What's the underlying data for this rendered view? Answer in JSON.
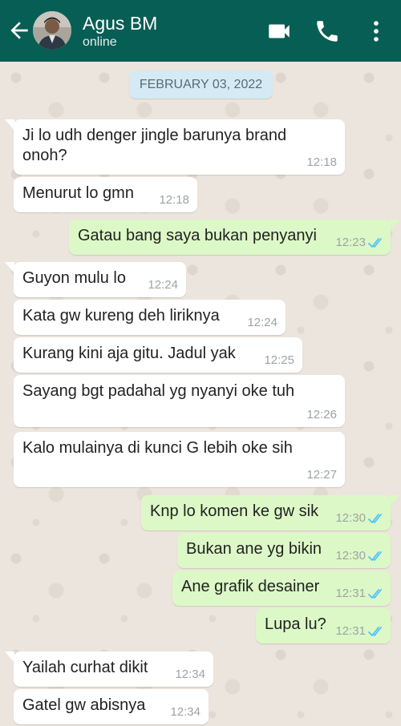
{
  "header": {
    "contact_name": "Agus BM",
    "status": "online",
    "icons": [
      "back-arrow-icon",
      "video-call-icon",
      "phone-icon",
      "more-vert-icon"
    ],
    "colors": {
      "bar": "#075e54",
      "text": "#ffffff"
    }
  },
  "chat": {
    "date_chip": "FEBRUARY 03, 2022",
    "colors": {
      "incoming": "#ffffff",
      "outgoing": "#dcf8c6",
      "read_ticks": "#4fc3f7",
      "wallpaper": "#ece5dd"
    },
    "messages": [
      {
        "dir": "in",
        "text": "Ji lo udh denger jingle barunya brand onoh?",
        "time": "12:18"
      },
      {
        "dir": "in",
        "text": "Menurut lo gmn",
        "time": "12:18"
      },
      {
        "dir": "out",
        "text": "Gatau bang saya bukan penyanyi",
        "time": "12:23",
        "status": "read"
      },
      {
        "dir": "in",
        "text": "Guyon mulu lo",
        "time": "12:24"
      },
      {
        "dir": "in",
        "text": "Kata gw kureng deh liriknya",
        "time": "12:24"
      },
      {
        "dir": "in",
        "text": "Kurang kini aja gitu. Jadul yak",
        "time": "12:25"
      },
      {
        "dir": "in",
        "text": "Sayang bgt padahal yg nyanyi oke tuh",
        "time": "12:26"
      },
      {
        "dir": "in",
        "text": "Kalo mulainya di kunci G lebih oke sih",
        "time": "12:27"
      },
      {
        "dir": "out",
        "text": "Knp lo komen ke gw sik",
        "time": "12:30",
        "status": "read"
      },
      {
        "dir": "out",
        "text": "Bukan ane yg bikin",
        "time": "12:30",
        "status": "read"
      },
      {
        "dir": "out",
        "text": "Ane grafik desainer",
        "time": "12:31",
        "status": "read"
      },
      {
        "dir": "out",
        "text": "Lupa lu?",
        "time": "12:31",
        "status": "read"
      },
      {
        "dir": "in",
        "text": "Yailah curhat dikit",
        "time": "12:34"
      },
      {
        "dir": "in",
        "text": "Gatel gw abisnya",
        "time": "12:34"
      }
    ]
  }
}
